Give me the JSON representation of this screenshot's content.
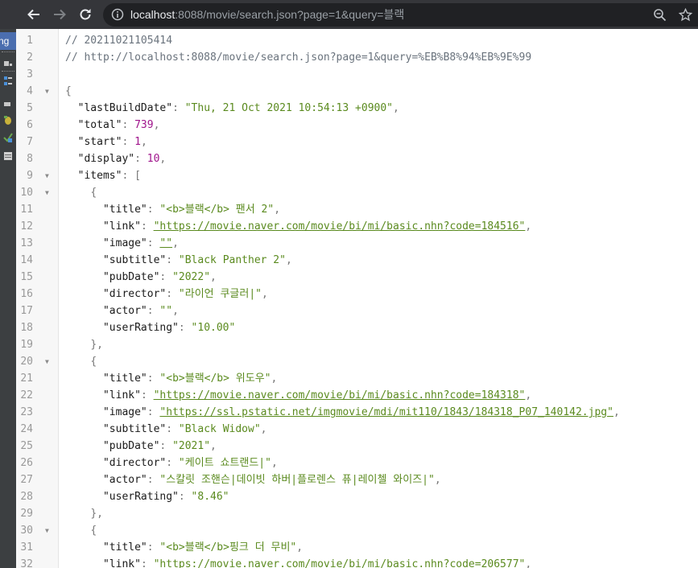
{
  "browser": {
    "url_host": "localhost",
    "url_rest": ":8088/movie/search.json?page=1&query=블랙"
  },
  "side_window": {
    "tab_label": "ng"
  },
  "colors": {
    "toolbar": "#35363a",
    "omnibox": "#202124",
    "string": "#5a8a1e",
    "number": "#a0158c"
  },
  "viewer": {
    "comment_timestamp": "// 20211021105414",
    "comment_url": "// http://localhost:8088/movie/search.json?page=1&query=%EB%B8%94%EB%9E%99",
    "lastBuildDate_key": "\"lastBuildDate\"",
    "lastBuildDate": "\"Thu, 21 Oct 2021 10:54:13 +0900\"",
    "total_key": "\"total\"",
    "total": "739",
    "start_key": "\"start\"",
    "start": "1",
    "display_key": "\"display\"",
    "display": "10",
    "items_key": "\"items\"",
    "items": [
      {
        "title": "\"<b>블랙</b> 팬서 2\"",
        "link": "\"https://movie.naver.com/movie/bi/mi/basic.nhn?code=184516\"",
        "image": "\"\"",
        "subtitle": "\"Black Panther 2\"",
        "pubDate": "\"2022\"",
        "director": "\"라이언 쿠글러|\"",
        "actor": "\"\"",
        "userRating": "\"10.00\""
      },
      {
        "title": "\"<b>블랙</b> 위도우\"",
        "link": "\"https://movie.naver.com/movie/bi/mi/basic.nhn?code=184318\"",
        "image": "\"https://ssl.pstatic.net/imgmovie/mdi/mit110/1843/184318_P07_140142.jpg\"",
        "subtitle": "\"Black Widow\"",
        "pubDate": "\"2021\"",
        "director": "\"케이트 쇼트랜드|\"",
        "actor": "\"스칼릿 조핸슨|데이빗 하버|플로렌스 퓨|레이첼 와이즈|\"",
        "userRating": "\"8.46\""
      },
      {
        "title": "\"<b>블랙</b>핑크 더 무비\"",
        "link": "\"https://movie.naver.com/movie/bi/mi/basic.nhn?code=206577\""
      }
    ]
  }
}
